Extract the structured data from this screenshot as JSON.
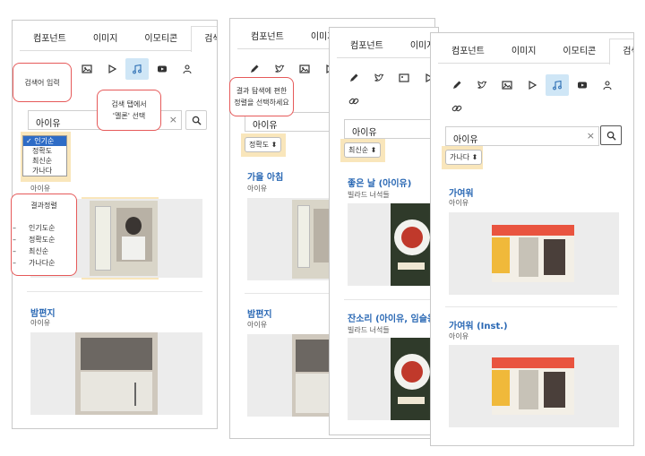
{
  "tabs": [
    "컴포넌트",
    "이미지",
    "이모티콘",
    "검색"
  ],
  "search": {
    "value": "아이유"
  },
  "callouts": {
    "input": "검색어 입력",
    "melon_line1": "검색 탭에서",
    "melon_line2": "'멜론' 선택",
    "sort_title": "결과정렬",
    "sort_select_line1": "결과 탐색에 편한",
    "sort_select_line2": "정렬을 선택하세요"
  },
  "sort_options": [
    "인기순",
    "정확도",
    "최신순",
    "가나다"
  ],
  "sort_result_list": [
    "인기도순",
    "정확도순",
    "최신순",
    "가나다순"
  ],
  "panel1": {
    "sort_selected": "인기순",
    "results": [
      {
        "title": "",
        "artist": "아이유"
      },
      {
        "title": "밤편지",
        "artist": "아이유"
      }
    ]
  },
  "panel2": {
    "sort_selected": "정확도",
    "results": [
      {
        "title": "가을 아침",
        "artist": "아이유"
      },
      {
        "title": "밤편지",
        "artist": "아이유"
      }
    ]
  },
  "panel3": {
    "sort_selected": "최신순",
    "results": [
      {
        "title": "좋은 날 (아이유)",
        "artist": "빌라드 너석들"
      },
      {
        "title": "잔소리 (아이유, 임슬옹)",
        "artist": "빌라드 너석들"
      }
    ]
  },
  "panel4": {
    "sort_selected": "가나다",
    "results": [
      {
        "title": "가여워",
        "artist": "아이유"
      },
      {
        "title": "가여워 (Inst.)",
        "artist": "아이유"
      }
    ]
  }
}
